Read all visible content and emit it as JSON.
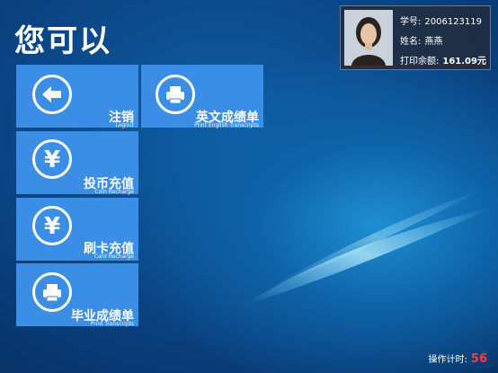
{
  "header": {
    "title": "您可以"
  },
  "tiles": [
    {
      "label": "注销",
      "sub": "Logout",
      "icon": "arrow-left-icon"
    },
    {
      "label": "英文成绩单",
      "sub": "Print English Transcripts",
      "icon": "printer-icon"
    },
    {
      "label": "投币充值",
      "sub": "Coin Recharge",
      "icon": "yen-icon"
    },
    {
      "label": "刷卡充值",
      "sub": "Card Recharge",
      "icon": "yen-icon"
    },
    {
      "label": "毕业成绩单",
      "sub": "Print Transcripts",
      "icon": "printer-icon"
    }
  ],
  "user": {
    "id_label": "学号:",
    "id_value": "2006123119",
    "name_label": "姓名:",
    "name_value": "燕燕",
    "balance_label": "打印余额:",
    "balance_value": "161.09元"
  },
  "timer": {
    "label": "操作计时:",
    "value": "56"
  },
  "colors": {
    "tile": "#3b8ee6",
    "timer_value": "#ff3b3b"
  }
}
